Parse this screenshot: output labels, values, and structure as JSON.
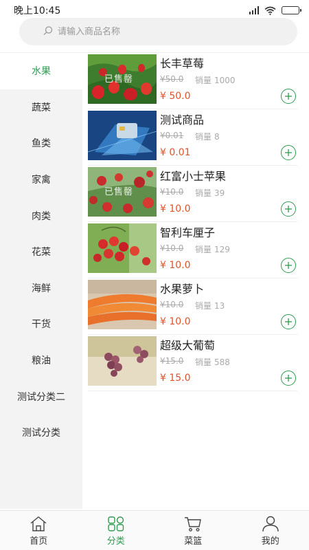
{
  "status_bar": {
    "time": "晚上10:45"
  },
  "search": {
    "placeholder": "请输入商品名称"
  },
  "categories": [
    {
      "label": "水果",
      "active": true
    },
    {
      "label": "蔬菜"
    },
    {
      "label": "鱼类"
    },
    {
      "label": "家禽"
    },
    {
      "label": "肉类"
    },
    {
      "label": "花菜"
    },
    {
      "label": "海鲜"
    },
    {
      "label": "干货"
    },
    {
      "label": "粮油"
    },
    {
      "label": "测试分类二"
    },
    {
      "label": "测试分类"
    }
  ],
  "sales_label": "销量",
  "sold_out_label": "已售罄",
  "products": [
    {
      "name": "长丰草莓",
      "old_price": "¥50.0",
      "sales": "1000",
      "price": "¥ 50.0",
      "sold_out": true
    },
    {
      "name": "测试商品",
      "old_price": "¥0.01",
      "sales": "8",
      "price": "¥ 0.01"
    },
    {
      "name": "红富小士苹果",
      "old_price": "¥10.0",
      "sales": "39",
      "price": "¥ 10.0",
      "sold_out": true
    },
    {
      "name": "智利车厘子",
      "old_price": "¥10.0",
      "sales": "129",
      "price": "¥ 10.0"
    },
    {
      "name": "水果萝卜",
      "old_price": "¥10.0",
      "sales": "13",
      "price": "¥ 10.0"
    },
    {
      "name": "超级大葡萄",
      "old_price": "¥15.0",
      "sales": "588",
      "price": "¥ 15.0"
    }
  ],
  "tabs": [
    {
      "label": "首页",
      "icon": "home-icon"
    },
    {
      "label": "分类",
      "icon": "category-icon",
      "active": true
    },
    {
      "label": "菜篮",
      "icon": "cart-icon"
    },
    {
      "label": "我的",
      "icon": "user-icon"
    }
  ],
  "colors": {
    "accent": "#2e9b4f",
    "price": "#e0522a"
  }
}
